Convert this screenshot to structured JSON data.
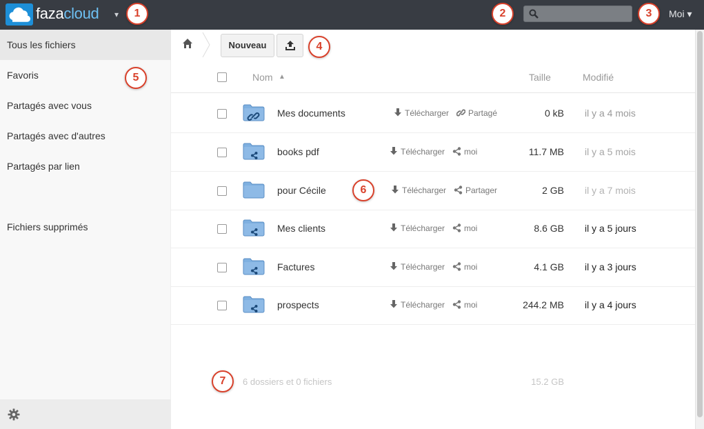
{
  "header": {
    "logo_word_1": "faza",
    "logo_word_2": "cloud",
    "caret": "▾",
    "search_placeholder": "",
    "user_menu": "Moi ▾"
  },
  "markers": [
    "1",
    "2",
    "3",
    "4",
    "5",
    "6",
    "7"
  ],
  "sidebar": {
    "items": [
      {
        "label": "Tous les fichiers",
        "active": true
      },
      {
        "label": "Favoris"
      },
      {
        "label": "Partagés avec vous"
      },
      {
        "label": "Partagés avec d'autres"
      },
      {
        "label": "Partagés par lien"
      },
      {
        "label": "Fichiers supprimés"
      }
    ],
    "settings_icon": "gear-icon"
  },
  "controls": {
    "home_icon": "home-icon",
    "new_button": "Nouveau",
    "upload_icon": "upload-icon"
  },
  "table": {
    "headers": {
      "name": "Nom",
      "sort_indicator": "▲",
      "size": "Taille",
      "modified": "Modifié"
    },
    "rows": [
      {
        "name": "Mes documents",
        "folder_type": "link",
        "download": "Télécharger",
        "share": "Partagé",
        "share_icon": "link-icon",
        "size": "0 kB",
        "modified": "il y a 4 mois",
        "modified_color": "#9a9a9a"
      },
      {
        "name": "books pdf",
        "folder_type": "shared",
        "download": "Télécharger",
        "share": "moi",
        "share_icon": "share-icon",
        "size": "11.7 MB",
        "modified": "il y a 5 mois",
        "modified_color": "#a6a6a6"
      },
      {
        "name": "pour Cécile",
        "folder_type": "plain",
        "download": "Télécharger",
        "share": "Partager",
        "share_icon": "share-icon",
        "size": "2 GB",
        "modified": "il y a 7 mois",
        "modified_color": "#b3b3b3"
      },
      {
        "name": "Mes clients",
        "folder_type": "shared",
        "download": "Télécharger",
        "share": "moi",
        "share_icon": "share-icon",
        "size": "8.6 GB",
        "modified": "il y a 5 jours",
        "modified_color": "#222222"
      },
      {
        "name": "Factures",
        "folder_type": "shared",
        "download": "Télécharger",
        "share": "moi",
        "share_icon": "share-icon",
        "size": "4.1 GB",
        "modified": "il y a 3 jours",
        "modified_color": "#222222"
      },
      {
        "name": "prospects",
        "folder_type": "shared",
        "download": "Télécharger",
        "share": "moi",
        "share_icon": "share-icon",
        "size": "244.2 MB",
        "modified": "il y a 4 jours",
        "modified_color": "#222222"
      }
    ],
    "summary": {
      "text": "6 dossiers et 0 fichiers",
      "size": "15.2 GB"
    }
  },
  "colors": {
    "topbar": "#383c43",
    "accent": "#1d8fd8",
    "marker": "#d9412b",
    "folder": "#6fa3d8"
  }
}
